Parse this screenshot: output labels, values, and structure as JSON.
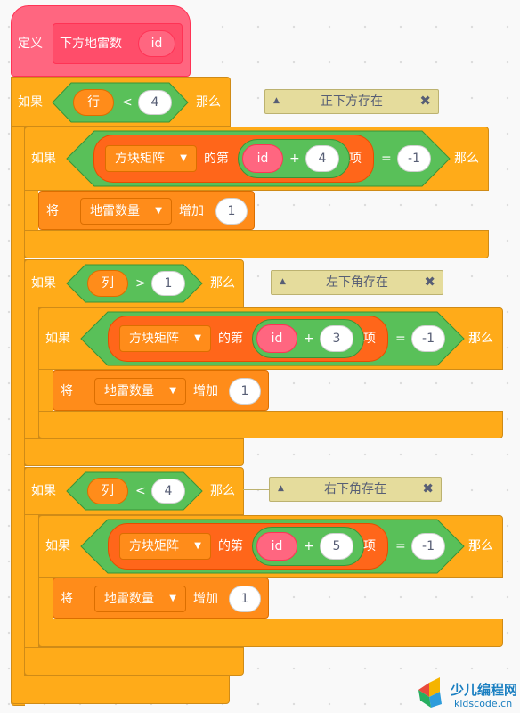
{
  "define": {
    "keyword": "定义",
    "proc_name": "下方地雷数",
    "param": "id"
  },
  "if1": {
    "keyword": "如果",
    "then": "那么",
    "var": "行",
    "op": "<",
    "value": "4",
    "comment": "正下方存在",
    "inner_if": {
      "keyword": "如果",
      "then": "那么",
      "list": "方块矩阵",
      "item_of": "的第",
      "param": "id",
      "plus": "+",
      "offset": "4",
      "item": "项",
      "eq": "=",
      "target": "-1"
    },
    "change": {
      "keyword": "将",
      "var": "地雷数量",
      "by": "增加",
      "value": "1"
    }
  },
  "if2": {
    "keyword": "如果",
    "then": "那么",
    "var": "列",
    "op": ">",
    "value": "1",
    "comment": "左下角存在",
    "inner_if": {
      "keyword": "如果",
      "then": "那么",
      "list": "方块矩阵",
      "item_of": "的第",
      "param": "id",
      "plus": "+",
      "offset": "3",
      "item": "项",
      "eq": "=",
      "target": "-1"
    },
    "change": {
      "keyword": "将",
      "var": "地雷数量",
      "by": "增加",
      "value": "1"
    }
  },
  "if3": {
    "keyword": "如果",
    "then": "那么",
    "var": "列",
    "op": "<",
    "value": "4",
    "comment": "右下角存在",
    "inner_if": {
      "keyword": "如果",
      "then": "那么",
      "list": "方块矩阵",
      "item_of": "的第",
      "param": "id",
      "plus": "+",
      "offset": "5",
      "item": "项",
      "eq": "=",
      "target": "-1"
    },
    "change": {
      "keyword": "将",
      "var": "地雷数量",
      "by": "增加",
      "value": "1"
    }
  },
  "watermark": {
    "title": "少儿编程网",
    "url": "kidscode.cn"
  },
  "colors": {
    "control": "#ffab19",
    "variable": "#ff8c1a",
    "list": "#ff661a",
    "operator": "#59c059",
    "custom": "#ff6680",
    "comment": "#e5dc9c"
  },
  "icons": {
    "dropdown": "caret-down-icon",
    "comment_collapse": "triangle-up-icon",
    "comment_close": "close-icon"
  }
}
